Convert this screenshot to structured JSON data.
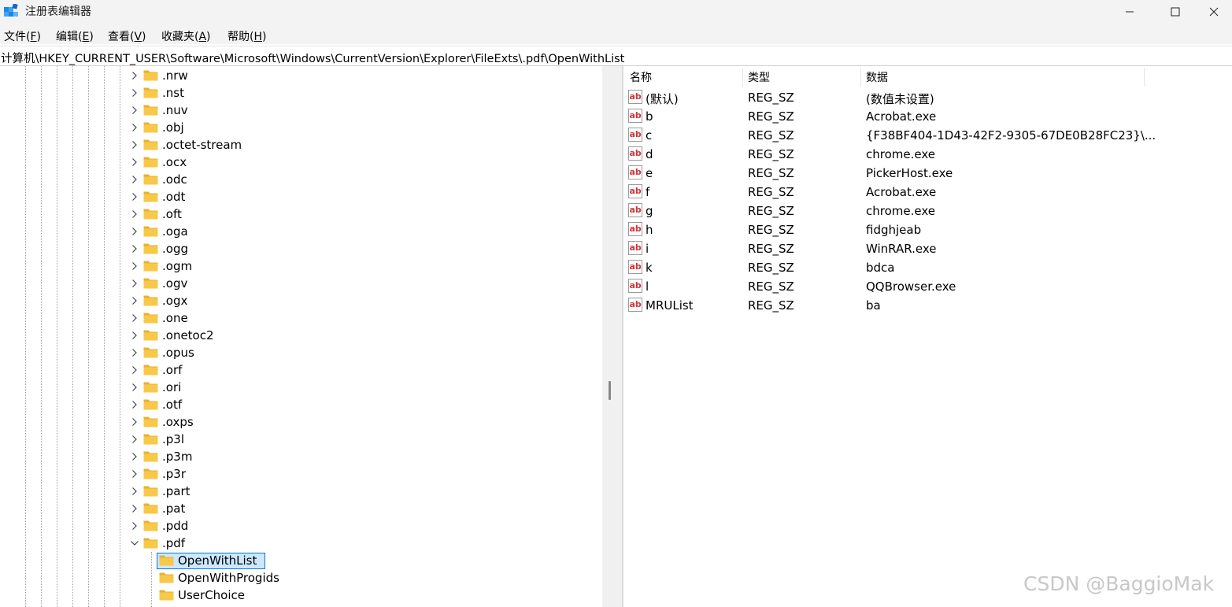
{
  "window": {
    "title": "注册表编辑器",
    "minimize_glyph": "—",
    "maximize_glyph": "□",
    "close_glyph": "✕"
  },
  "menu": [
    {
      "label": "文件(",
      "key": "F",
      "end": ")"
    },
    {
      "label": "编辑(",
      "key": "E",
      "end": ")"
    },
    {
      "label": "查看(",
      "key": "V",
      "end": ")"
    },
    {
      "label": "收藏夹(",
      "key": "A",
      "end": ")"
    },
    {
      "label": "帮助(",
      "key": "H",
      "end": ")"
    }
  ],
  "address": "计算机\\HKEY_CURRENT_USER\\Software\\Microsoft\\Windows\\CurrentVersion\\Explorer\\FileExts\\.pdf\\OpenWithList",
  "tree": {
    "items": [
      {
        "label": ".nrw",
        "state": "collapsed"
      },
      {
        "label": ".nst",
        "state": "collapsed"
      },
      {
        "label": ".nuv",
        "state": "collapsed"
      },
      {
        "label": ".obj",
        "state": "collapsed"
      },
      {
        "label": ".octet-stream",
        "state": "collapsed"
      },
      {
        "label": ".ocx",
        "state": "collapsed"
      },
      {
        "label": ".odc",
        "state": "collapsed"
      },
      {
        "label": ".odt",
        "state": "collapsed"
      },
      {
        "label": ".oft",
        "state": "collapsed"
      },
      {
        "label": ".oga",
        "state": "collapsed"
      },
      {
        "label": ".ogg",
        "state": "collapsed"
      },
      {
        "label": ".ogm",
        "state": "collapsed"
      },
      {
        "label": ".ogv",
        "state": "collapsed"
      },
      {
        "label": ".ogx",
        "state": "collapsed"
      },
      {
        "label": ".one",
        "state": "collapsed"
      },
      {
        "label": ".onetoc2",
        "state": "collapsed"
      },
      {
        "label": ".opus",
        "state": "collapsed"
      },
      {
        "label": ".orf",
        "state": "collapsed"
      },
      {
        "label": ".ori",
        "state": "collapsed"
      },
      {
        "label": ".otf",
        "state": "collapsed"
      },
      {
        "label": ".oxps",
        "state": "collapsed"
      },
      {
        "label": ".p3l",
        "state": "collapsed"
      },
      {
        "label": ".p3m",
        "state": "collapsed"
      },
      {
        "label": ".p3r",
        "state": "collapsed"
      },
      {
        "label": ".part",
        "state": "collapsed"
      },
      {
        "label": ".pat",
        "state": "collapsed"
      },
      {
        "label": ".pdd",
        "state": "collapsed"
      },
      {
        "label": ".pdf",
        "state": "expanded"
      },
      {
        "label": "OpenWithList",
        "state": "leaf",
        "child": true,
        "selected": true
      },
      {
        "label": "OpenWithProgids",
        "state": "leaf",
        "child": true
      },
      {
        "label": "UserChoice",
        "state": "leaf",
        "child": true
      }
    ]
  },
  "list": {
    "columns": [
      "名称",
      "类型",
      "数据"
    ],
    "rows": [
      {
        "name": "(默认)",
        "type": "REG_SZ",
        "data": "(数值未设置)"
      },
      {
        "name": "b",
        "type": "REG_SZ",
        "data": "Acrobat.exe"
      },
      {
        "name": "c",
        "type": "REG_SZ",
        "data": "{F38BF404-1D43-42F2-9305-67DE0B28FC23}\\..."
      },
      {
        "name": "d",
        "type": "REG_SZ",
        "data": "chrome.exe"
      },
      {
        "name": "e",
        "type": "REG_SZ",
        "data": "PickerHost.exe"
      },
      {
        "name": "f",
        "type": "REG_SZ",
        "data": "Acrobat.exe"
      },
      {
        "name": "g",
        "type": "REG_SZ",
        "data": "chrome.exe"
      },
      {
        "name": "h",
        "type": "REG_SZ",
        "data": "fidghjeab"
      },
      {
        "name": "i",
        "type": "REG_SZ",
        "data": "WinRAR.exe"
      },
      {
        "name": "k",
        "type": "REG_SZ",
        "data": "bdca"
      },
      {
        "name": "l",
        "type": "REG_SZ",
        "data": "QQBrowser.exe"
      },
      {
        "name": "MRUList",
        "type": "REG_SZ",
        "data": "ba"
      }
    ]
  },
  "value_icon_text": "ab",
  "watermark": "CSDN @BaggioMak",
  "colors": {
    "folder": "#f8c84a",
    "selection_fill": "#cce8ff",
    "selection_border": "#0078d4",
    "value_icon": "#d13438"
  }
}
